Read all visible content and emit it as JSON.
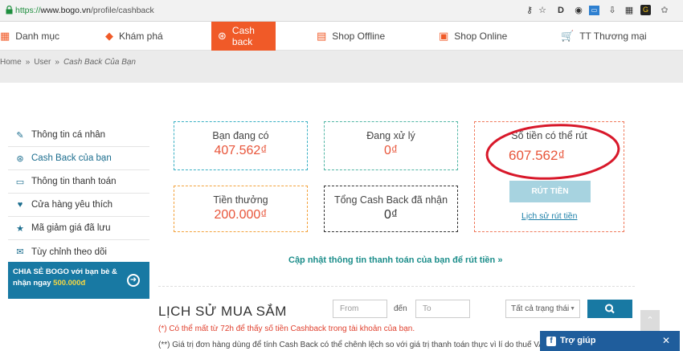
{
  "browser": {
    "url_scheme": "https://",
    "url_host": "www.bogo.vn",
    "url_path": "/profile/cashback"
  },
  "nav": {
    "items": [
      {
        "label": "Danh mục",
        "icon": "grid-icon"
      },
      {
        "label": "Khám phá",
        "icon": "tag-icon"
      },
      {
        "label": "Cash back",
        "icon": "cashback-icon"
      },
      {
        "label": "Shop Offline",
        "icon": "store-icon"
      },
      {
        "label": "Shop Online",
        "icon": "bag-icon"
      },
      {
        "label": "TT Thương mại",
        "icon": "cart-icon"
      }
    ]
  },
  "breadcrumb": {
    "home": "Home",
    "user": "User",
    "current": "Cash Back Của Bạn"
  },
  "sidebar": {
    "items": [
      {
        "label": "Thông tin cá nhân",
        "icon": "pencil-icon"
      },
      {
        "label": "Cash Back của bạn",
        "icon": "cashback-icon"
      },
      {
        "label": "Thông tin thanh toán",
        "icon": "card-icon"
      },
      {
        "label": "Cửa hàng yêu thích",
        "icon": "heart-icon"
      },
      {
        "label": "Mã giảm giá đã lưu",
        "icon": "star-icon"
      },
      {
        "label": "Tùy chỉnh theo dõi",
        "icon": "mail-icon"
      }
    ],
    "share_line1": "CHIA SẺ BOGO với bạn bè &",
    "share_line2": "nhận ngay ",
    "share_amount": "500.000đ"
  },
  "stats": {
    "balance_label": "Bạn đang có",
    "balance_value": "407.562₫",
    "processing_label": "Đang xử lý",
    "processing_value": "0₫",
    "withdrawable_label": "Số tiền có thể rút",
    "withdrawable_value": "607.562₫",
    "bonus_label": "Tiền thưởng",
    "bonus_value": "200.000₫",
    "total_label": "Tổng Cash Back đã nhận",
    "total_value": "0₫",
    "withdraw_button": "RÚT TIỀN",
    "withdraw_history": "Lịch sử rút tiền"
  },
  "update_link": "Cập nhật thông tin thanh toán của bạn để rút tiền »",
  "history": {
    "title": "LỊCH SỬ MUA SẮM",
    "from_placeholder": "From",
    "to_label": "đến",
    "to_placeholder": "To",
    "status_select": "Tất cả trạng thái",
    "note1": "(*) Có thể mất từ 72h để thấy số tiền Cashback trong tài khoản của bạn.",
    "note2": "(**) Giá trị đơn hàng dùng để tính Cash Back có thể chênh lệch so với giá trị thanh toán thực vì lí do thuế VAT"
  },
  "help_widget": {
    "label": "Trợ giúp"
  },
  "colors": {
    "accent": "#f05a28",
    "primary": "#1879a3",
    "annotation": "#d8182a"
  }
}
